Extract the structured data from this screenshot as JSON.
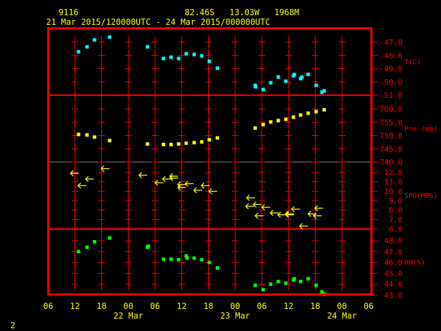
{
  "header": {
    "station": "9116",
    "location": "82.46S   13.03W   1968M",
    "period": "21 Mar 2015/120000UTC - 24 Mar 2015/000000UTC"
  },
  "footer": {
    "page": "2"
  },
  "colors": {
    "frame": "#ff0000",
    "text": "#ffff00",
    "temp": "#00ffff",
    "pressure": "#ffff00",
    "wind": "#ffff00",
    "rh": "#00ff00"
  },
  "chart_data": {
    "type": "scatter",
    "x_units": "hours since 21 Mar 2015 06UTC",
    "xlim": [
      0,
      72
    ],
    "x_ticks": [
      "06",
      "12",
      "18",
      "00",
      "06",
      "12",
      "18",
      "00",
      "06",
      "12",
      "18",
      "00",
      "06"
    ],
    "x_date_labels": [
      {
        "label": "22 Mar",
        "hour": 18
      },
      {
        "label": "23 Mar",
        "hour": 42
      },
      {
        "label": "24 Mar",
        "hour": 66
      }
    ],
    "panels": [
      {
        "name": "temperature",
        "label": "T(C)",
        "ylim": [
          -51,
          -46.5
        ],
        "ticks": [
          "-47.0",
          "-48.0",
          "-49.0",
          "-50.0",
          "-51.0"
        ],
        "tick_values": [
          -47,
          -48,
          -49,
          -50,
          -51
        ],
        "points": [
          [
            6.8,
            -47.73
          ],
          [
            8.7,
            -47.36
          ],
          [
            10.4,
            -46.84
          ],
          [
            13.8,
            -46.63
          ],
          [
            22.3,
            -47.36
          ],
          [
            25.9,
            -48.24
          ],
          [
            27.6,
            -48.14
          ],
          [
            29.3,
            -48.24
          ],
          [
            31.0,
            -47.88
          ],
          [
            32.8,
            -47.93
          ],
          [
            34.5,
            -48.04
          ],
          [
            36.2,
            -48.45
          ],
          [
            38.0,
            -48.97
          ],
          [
            46.5,
            -50.26
          ],
          [
            46.6,
            -50.37
          ],
          [
            48.3,
            -50.58
          ],
          [
            50.0,
            -50.06
          ],
          [
            51.7,
            -49.64
          ],
          [
            53.4,
            -49.95
          ],
          [
            55.1,
            -49.54
          ],
          [
            55.3,
            -49.44
          ],
          [
            56.7,
            -49.75
          ],
          [
            57.0,
            -49.64
          ],
          [
            58.4,
            -49.44
          ],
          [
            60.2,
            -50.26
          ],
          [
            61.5,
            -50.78
          ],
          [
            62.0,
            -50.68
          ]
        ]
      },
      {
        "name": "pressure",
        "label": "Pre (mb)",
        "ylim": [
          740,
          765
        ],
        "ticks": [
          "760.0",
          "755.0",
          "750.0",
          "745.0",
          "740.0"
        ],
        "tick_values": [
          760,
          755,
          750,
          745,
          740
        ],
        "points": [
          [
            6.8,
            750.4
          ],
          [
            8.7,
            750.2
          ],
          [
            10.4,
            749.4
          ],
          [
            13.8,
            748.1
          ],
          [
            22.3,
            746.8
          ],
          [
            25.9,
            746.6
          ],
          [
            27.6,
            746.6
          ],
          [
            29.3,
            746.8
          ],
          [
            31.0,
            747.1
          ],
          [
            32.8,
            747.3
          ],
          [
            34.5,
            747.6
          ],
          [
            36.2,
            748.4
          ],
          [
            38.0,
            749.1
          ],
          [
            46.5,
            752.8
          ],
          [
            48.3,
            754.1
          ],
          [
            50.0,
            755.1
          ],
          [
            51.7,
            755.6
          ],
          [
            53.4,
            756.1
          ],
          [
            55.1,
            756.9
          ],
          [
            56.7,
            757.7
          ],
          [
            58.4,
            758.4
          ],
          [
            60.2,
            759.0
          ],
          [
            62.0,
            759.7
          ]
        ]
      },
      {
        "name": "wind_speed",
        "label": "SPD(MPS)",
        "ylim": [
          6,
          13
        ],
        "ticks": [
          "12.0",
          "11.0",
          "10.0",
          "9.0",
          "8.0",
          "7.0",
          "6.0"
        ],
        "tick_values": [
          12,
          11,
          10,
          9,
          8,
          7,
          6
        ],
        "wind_direction": "easterly (arrows point west)",
        "points": [
          [
            5.0,
            11.9
          ],
          [
            11.9,
            12.4
          ],
          [
            8.4,
            11.3
          ],
          [
            6.7,
            10.6
          ],
          [
            20.4,
            11.7
          ],
          [
            24.0,
            10.9
          ],
          [
            25.7,
            11.3
          ],
          [
            27.3,
            11.6
          ],
          [
            27.4,
            11.4
          ],
          [
            29.1,
            10.7
          ],
          [
            29.1,
            10.4
          ],
          [
            30.8,
            10.8
          ],
          [
            32.7,
            10.1
          ],
          [
            34.4,
            10.6
          ],
          [
            36.1,
            10.0
          ],
          [
            44.6,
            9.3
          ],
          [
            44.4,
            8.4
          ],
          [
            46.1,
            8.6
          ],
          [
            48.0,
            8.3
          ],
          [
            46.5,
            7.4
          ],
          [
            49.9,
            7.7
          ],
          [
            51.6,
            7.5
          ],
          [
            53.3,
            7.6
          ],
          [
            53.4,
            7.5
          ],
          [
            54.7,
            8.1
          ],
          [
            56.5,
            6.3
          ],
          [
            58.4,
            7.6
          ],
          [
            59.6,
            7.4
          ],
          [
            59.9,
            8.2
          ]
        ]
      },
      {
        "name": "relative_humidity",
        "label": "RH(%)",
        "ylim": [
          43,
          49
        ],
        "ticks": [
          "48.0",
          "47.0",
          "46.0",
          "45.0",
          "44.0",
          "43.0"
        ],
        "tick_values": [
          48,
          47,
          46,
          45,
          44,
          43
        ],
        "points": [
          [
            6.8,
            47.0
          ],
          [
            8.7,
            47.4
          ],
          [
            10.4,
            47.9
          ],
          [
            13.8,
            48.25
          ],
          [
            22.3,
            47.4
          ],
          [
            22.5,
            47.5
          ],
          [
            25.9,
            46.3
          ],
          [
            27.6,
            46.3
          ],
          [
            29.3,
            46.25
          ],
          [
            31.0,
            46.6
          ],
          [
            31.2,
            46.4
          ],
          [
            32.8,
            46.4
          ],
          [
            34.5,
            46.25
          ],
          [
            36.2,
            46.0
          ],
          [
            38.0,
            45.5
          ],
          [
            46.5,
            43.9
          ],
          [
            48.3,
            43.5
          ],
          [
            50.0,
            44.0
          ],
          [
            51.7,
            44.25
          ],
          [
            53.4,
            44.1
          ],
          [
            55.1,
            44.4
          ],
          [
            55.3,
            44.5
          ],
          [
            56.7,
            44.25
          ],
          [
            58.4,
            44.5
          ],
          [
            60.2,
            43.9
          ],
          [
            61.5,
            43.3
          ],
          [
            62.0,
            43.1
          ]
        ]
      }
    ]
  }
}
